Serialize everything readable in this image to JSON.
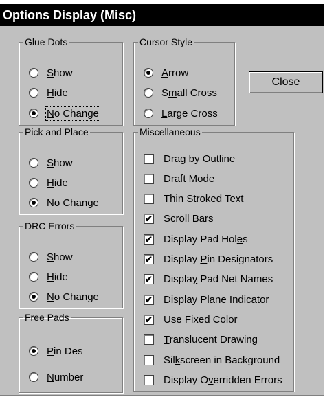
{
  "dialog": {
    "title": "Options Display (Misc)",
    "close_label": "Close"
  },
  "glue_dots": {
    "title": "Glue Dots",
    "options": [
      {
        "pre": "",
        "u": "S",
        "post": "how",
        "selected": false
      },
      {
        "pre": "",
        "u": "H",
        "post": "ide",
        "selected": false
      },
      {
        "pre": "",
        "u": "N",
        "post": "o Change",
        "selected": true
      }
    ]
  },
  "cursor_style": {
    "title": "Cursor Style",
    "options": [
      {
        "pre": "",
        "u": "A",
        "post": "rrow",
        "selected": true
      },
      {
        "pre": "S",
        "u": "m",
        "post": "all Cross",
        "selected": false
      },
      {
        "pre": "",
        "u": "L",
        "post": "arge Cross",
        "selected": false
      }
    ]
  },
  "pick_and_place": {
    "title": "Pick and Place",
    "options": [
      {
        "pre": "",
        "u": "S",
        "post": "how",
        "selected": false
      },
      {
        "pre": "",
        "u": "H",
        "post": "ide",
        "selected": false
      },
      {
        "pre": "",
        "u": "N",
        "post": "o Change",
        "selected": true
      }
    ]
  },
  "drc_errors": {
    "title": "DRC Errors",
    "options": [
      {
        "pre": "",
        "u": "S",
        "post": "how",
        "selected": false
      },
      {
        "pre": "",
        "u": "H",
        "post": "ide",
        "selected": false
      },
      {
        "pre": "",
        "u": "N",
        "post": "o Change",
        "selected": true
      }
    ]
  },
  "free_pads": {
    "title": "Free Pads",
    "options": [
      {
        "pre": "",
        "u": "P",
        "post": "in Des",
        "selected": true
      },
      {
        "pre": "",
        "u": "N",
        "post": "umber",
        "selected": false
      }
    ]
  },
  "miscellaneous": {
    "title": "Miscellaneous",
    "items": [
      {
        "pre": "Drag by ",
        "u": "O",
        "post": "utline",
        "checked": false
      },
      {
        "pre": "",
        "u": "D",
        "post": "raft Mode",
        "checked": false
      },
      {
        "pre": "Thin St",
        "u": "r",
        "post": "oked Text",
        "checked": false
      },
      {
        "pre": "Scroll ",
        "u": "B",
        "post": "ars",
        "checked": true
      },
      {
        "pre": "Display Pad Hol",
        "u": "e",
        "post": "s",
        "checked": true
      },
      {
        "pre": "Display ",
        "u": "P",
        "post": "in Designators",
        "checked": true
      },
      {
        "pre": "Displa",
        "u": "y",
        "post": " Pad Net Names",
        "checked": true
      },
      {
        "pre": "Display Plane ",
        "u": "I",
        "post": "ndicator",
        "checked": true
      },
      {
        "pre": "",
        "u": "U",
        "post": "se Fixed Color",
        "checked": true
      },
      {
        "pre": "",
        "u": "T",
        "post": "ranslucent Drawing",
        "checked": false
      },
      {
        "pre": "Sil",
        "u": "k",
        "post": "screen in Background",
        "checked": false
      },
      {
        "pre": "Display O",
        "u": "v",
        "post": "erridden Errors",
        "checked": false
      }
    ]
  },
  "icons": {
    "radio_on": "radio-selected-icon",
    "radio_off": "radio-unselected-icon",
    "check_on": "checkmark-icon"
  },
  "colors": {
    "face": "#c0c0c0",
    "title_bg": "#000000",
    "title_fg": "#ffffff"
  }
}
